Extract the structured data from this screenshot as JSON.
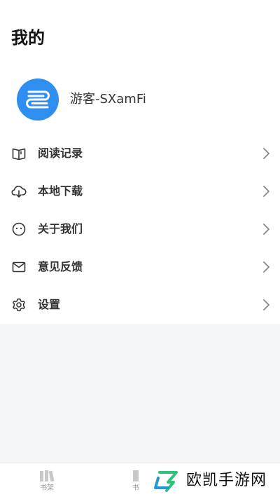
{
  "header": {
    "title": "我的"
  },
  "profile": {
    "username": "游客-SXamFi",
    "avatar_icon": "swirl-logo-icon",
    "avatar_color": "#2f8ff0"
  },
  "menu": {
    "items": [
      {
        "label": "阅读记录",
        "icon": "book-icon"
      },
      {
        "label": "本地下载",
        "icon": "cloud-download-icon"
      },
      {
        "label": "关于我们",
        "icon": "smiley-icon"
      },
      {
        "label": "意见反馈",
        "icon": "mail-icon"
      },
      {
        "label": "设置",
        "icon": "gear-icon"
      }
    ]
  },
  "tabbar": {
    "tabs": [
      {
        "label": "书架",
        "icon": "bookshelf-icon"
      },
      {
        "label": "书",
        "icon": "book-stack-icon"
      }
    ]
  },
  "watermark": {
    "text": "欧凯手游网"
  }
}
